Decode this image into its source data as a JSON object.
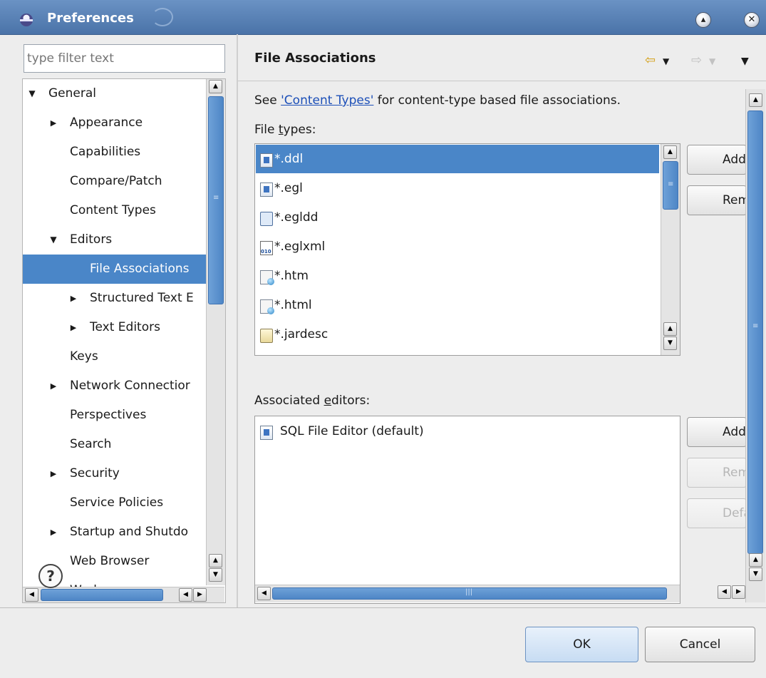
{
  "window": {
    "title": "Preferences"
  },
  "filter": {
    "placeholder": "type filter text"
  },
  "tree": {
    "items": [
      {
        "label": "General",
        "depth": 0,
        "expander": "expanded"
      },
      {
        "label": "Appearance",
        "depth": 1,
        "expander": "collapsed"
      },
      {
        "label": "Capabilities",
        "depth": 1,
        "expander": "none"
      },
      {
        "label": "Compare/Patch",
        "depth": 1,
        "expander": "none"
      },
      {
        "label": "Content Types",
        "depth": 1,
        "expander": "none"
      },
      {
        "label": "Editors",
        "depth": 1,
        "expander": "expanded"
      },
      {
        "label": "File Associations",
        "depth": 2,
        "expander": "none",
        "selected": true
      },
      {
        "label": "Structured Text E",
        "depth": 2,
        "expander": "collapsed"
      },
      {
        "label": "Text Editors",
        "depth": 2,
        "expander": "collapsed"
      },
      {
        "label": "Keys",
        "depth": 1,
        "expander": "none"
      },
      {
        "label": "Network Connectior",
        "depth": 1,
        "expander": "collapsed"
      },
      {
        "label": "Perspectives",
        "depth": 1,
        "expander": "none"
      },
      {
        "label": "Search",
        "depth": 1,
        "expander": "none"
      },
      {
        "label": "Security",
        "depth": 1,
        "expander": "collapsed"
      },
      {
        "label": "Service Policies",
        "depth": 1,
        "expander": "none"
      },
      {
        "label": "Startup and Shutdo",
        "depth": 1,
        "expander": "collapsed"
      },
      {
        "label": "Web Browser",
        "depth": 1,
        "expander": "none"
      },
      {
        "label": "Work",
        "depth": 1,
        "expander": "none"
      }
    ]
  },
  "page": {
    "title": "File Associations",
    "intro_prefix": "See ",
    "intro_link": "'Content Types'",
    "intro_suffix": " for content-type based file associations.",
    "file_types_label_pre": "File ",
    "file_types_label_mn": "t",
    "file_types_label_post": "ypes:",
    "editors_label_pre": "Associated ",
    "editors_label_mn": "e",
    "editors_label_post": "ditors:"
  },
  "file_types": [
    {
      "name": "*.ddl",
      "icon": "sql-file-icon",
      "selected": true
    },
    {
      "name": "*.egl",
      "icon": "egl-file-icon"
    },
    {
      "name": "*.egldd",
      "icon": "egldd-file-icon"
    },
    {
      "name": "*.eglxml",
      "icon": "eglxml-file-icon"
    },
    {
      "name": "*.htm",
      "icon": "html-file-icon"
    },
    {
      "name": "*.html",
      "icon": "html-file-icon"
    },
    {
      "name": "*.jardesc",
      "icon": "jar-file-icon"
    }
  ],
  "editors": [
    {
      "name": "SQL File Editor (default)",
      "icon": "sql-file-icon"
    }
  ],
  "buttons": {
    "add_type": "Add",
    "remove_type": "Remove",
    "add_editor": "Add",
    "remove_editor": "Remove",
    "default_editor": "Default",
    "ok": "OK",
    "cancel": "Cancel",
    "help": "?"
  },
  "colors": {
    "selection": "#4a86c8",
    "link": "#1c4fb8",
    "titlebar": "#5a82b8"
  }
}
